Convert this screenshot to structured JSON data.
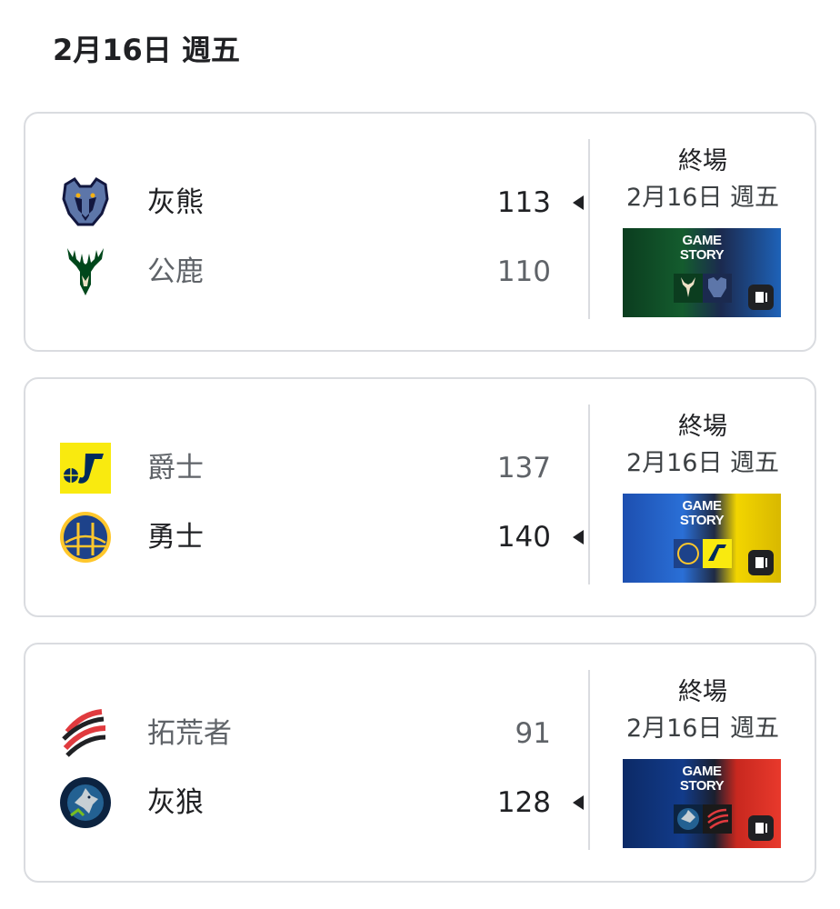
{
  "header": {
    "date": "2月16日 週五"
  },
  "games": [
    {
      "status": "終場",
      "date": "2月16日 週五",
      "teams": [
        {
          "name": "灰熊",
          "score": "113",
          "winner": true,
          "logo": "grizzlies-logo",
          "color": "#5D76A9"
        },
        {
          "name": "公鹿",
          "score": "110",
          "winner": false,
          "logo": "bucks-logo",
          "color": "#00471B"
        }
      ],
      "thumbnail": {
        "line1": "GAME",
        "line2": "STORY",
        "left_color": "#0b3d1f",
        "right_color": "#1e62b8"
      }
    },
    {
      "status": "終場",
      "date": "2月16日 週五",
      "teams": [
        {
          "name": "爵士",
          "score": "137",
          "winner": false,
          "logo": "jazz-logo",
          "color": "#F9EA0F"
        },
        {
          "name": "勇士",
          "score": "140",
          "winner": true,
          "logo": "warriors-logo",
          "color": "#1D428A"
        }
      ],
      "thumbnail": {
        "line1": "GAME",
        "line2": "STORY",
        "left_color": "#1d4fb0",
        "right_color": "#f2d500"
      }
    },
    {
      "status": "終場",
      "date": "2月16日 週五",
      "teams": [
        {
          "name": "拓荒者",
          "score": "91",
          "winner": false,
          "logo": "trail-blazers-logo",
          "color": "#E03A3E"
        },
        {
          "name": "灰狼",
          "score": "128",
          "winner": true,
          "logo": "timberwolves-logo",
          "color": "#0C2340"
        }
      ],
      "thumbnail": {
        "line1": "GAME",
        "line2": "STORY",
        "left_color": "#0c2a66",
        "right_color": "#e8392c"
      }
    }
  ]
}
